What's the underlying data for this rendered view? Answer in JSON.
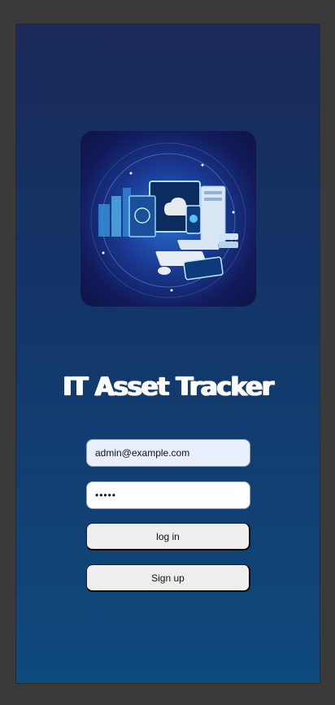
{
  "app": {
    "title": "IT Asset Tracker",
    "logo_icon": "it-assets-illustration"
  },
  "form": {
    "email_value": "admin@example.com",
    "password_value": "•••••",
    "login_label": "log in",
    "signup_label": "Sign up"
  },
  "colors": {
    "background_top": "#1a2a5a",
    "background_bottom": "#0f4a7c",
    "title": "#ffffff",
    "button_bg": "#eeeeee",
    "email_field_bg": "#e8effd"
  }
}
